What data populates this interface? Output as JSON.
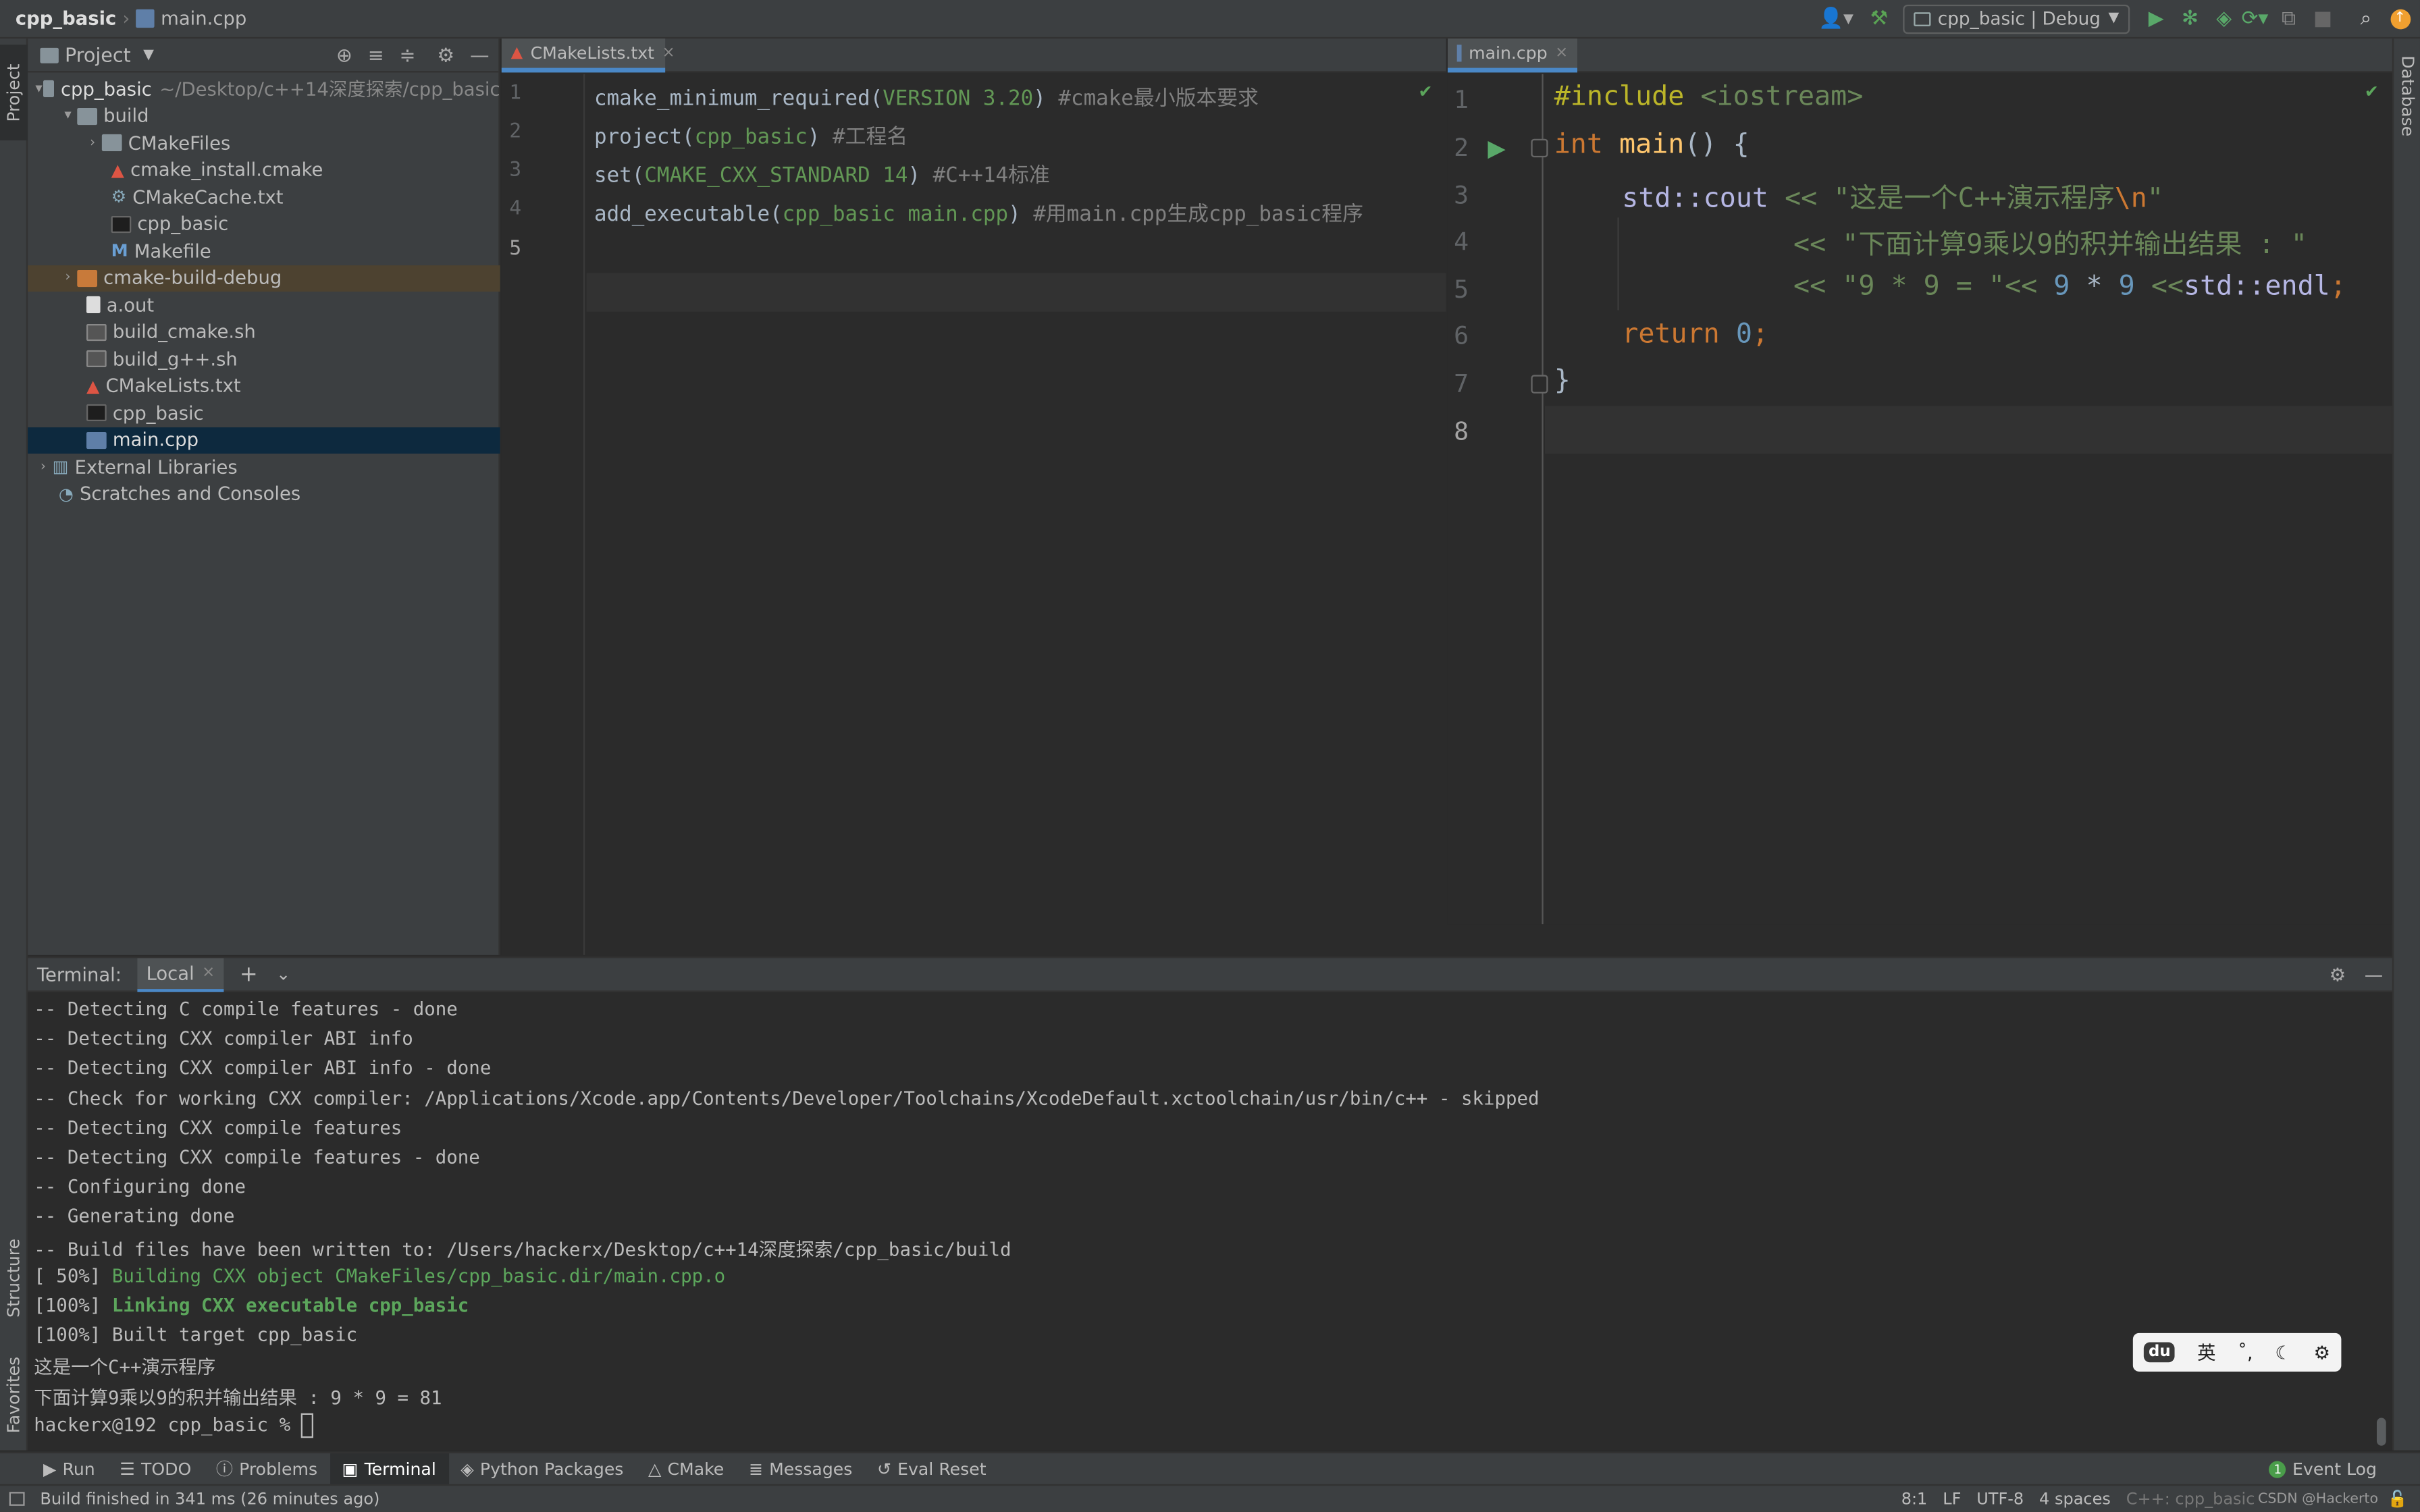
{
  "topbar": {
    "project": "cpp_basic",
    "file": "main.cpp",
    "run_config": "cpp_basic | Debug"
  },
  "sidebar_tabs": {
    "project": "Project",
    "structure": "Structure",
    "favorites": "Favorites",
    "database": "Database"
  },
  "project_panel": {
    "title": "Project",
    "root_name": "cpp_basic",
    "root_path": "~/Desktop/c++14深度探索/cpp_basic",
    "items": [
      {
        "label": "build"
      },
      {
        "label": "CMakeFiles"
      },
      {
        "label": "cmake_install.cmake"
      },
      {
        "label": "CMakeCache.txt"
      },
      {
        "label": "cpp_basic"
      },
      {
        "label": "Makefile"
      },
      {
        "label": "cmake-build-debug"
      },
      {
        "label": "a.out"
      },
      {
        "label": "build_cmake.sh"
      },
      {
        "label": "build_g++.sh"
      },
      {
        "label": "CMakeLists.txt"
      },
      {
        "label": "cpp_basic"
      },
      {
        "label": "main.cpp"
      },
      {
        "label": "External Libraries"
      },
      {
        "label": "Scratches and Consoles"
      }
    ]
  },
  "editor_left": {
    "tab": "CMakeLists.txt",
    "line_numbers": [
      "1",
      "2",
      "3",
      "4",
      "5"
    ],
    "lines": [
      {
        "a": "cmake_minimum_required(",
        "b": "VERSION 3.20",
        "c": ") ",
        "d": "#cmake最小版本要求"
      },
      {
        "a": "project(",
        "b": "cpp_basic",
        "c": ") ",
        "d": "#工程名"
      },
      {
        "a": "set(",
        "b": "CMAKE_CXX_STANDARD 14",
        "c": ") ",
        "d": "#C++14标准"
      },
      {
        "a": "add_executable(",
        "b": "cpp_basic main.cpp",
        "c": ") ",
        "d": "#用main.cpp生成cpp_basic程序"
      }
    ]
  },
  "editor_right": {
    "tab": "main.cpp",
    "line_numbers": [
      "1",
      "2",
      "3",
      "4",
      "5",
      "6",
      "7",
      "8"
    ],
    "code": {
      "l1_kw": "#include",
      "l1_hdr": " <iostream>",
      "l2_type": "int",
      "l2_fn": " main",
      "l2_rest": "() {",
      "l3_ns": "std::cout",
      "l3_op": " << ",
      "l3_str": "\"这是一个C++演示程序",
      "l3_esc": "\\n",
      "l3_end": "\"",
      "l4_op": "<< ",
      "l4_str": "\"下面计算9乘以9的积并输出结果 : \"",
      "l5_op": "<< ",
      "l5_str": "\"9 * 9 = \"",
      "l5_op2": "<< ",
      "l5_n1": "9",
      "l5_mul": " * ",
      "l5_n2": "9",
      "l5_op3": " <<",
      "l5_endl": "std::endl",
      "l5_semi": ";",
      "l6_kw": "return",
      "l6_num": " 0",
      "l6_semi": ";",
      "l7": "}"
    }
  },
  "terminal": {
    "label": "Terminal:",
    "tab": "Local",
    "lines": [
      "-- Detecting C compile features - done",
      "-- Detecting CXX compiler ABI info",
      "-- Detecting CXX compiler ABI info - done",
      "-- Check for working CXX compiler: /Applications/Xcode.app/Contents/Developer/Toolchains/XcodeDefault.xctoolchain/usr/bin/c++ - skipped",
      "-- Detecting CXX compile features",
      "-- Detecting CXX compile features - done",
      "-- Configuring done",
      "-- Generating done",
      "-- Build files have been written to: /Users/hackerx/Desktop/c++14深度探索/cpp_basic/build"
    ],
    "build1_prefix": "[ 50%] ",
    "build1_text": "Building CXX object CMakeFiles/cpp_basic.dir/main.cpp.o",
    "build2_prefix": "[100%] ",
    "build2_text": "Linking CXX executable cpp_basic",
    "build3": "[100%] Built target cpp_basic",
    "out1": "这是一个C++演示程序",
    "out2": "下面计算9乘以9的积并输出结果 : 9 * 9 = 81",
    "prompt": "hackerx@192 cpp_basic % "
  },
  "ime": {
    "lang": "英",
    "punct": "˚,",
    "logo": "du"
  },
  "bottom_tabs": [
    "Run",
    "TODO",
    "Problems",
    "Terminal",
    "Python Packages",
    "CMake",
    "Messages",
    "Eval Reset"
  ],
  "event_log": "Event Log",
  "status": {
    "message": "Build finished in 341 ms (26 minutes ago)",
    "position": "8:1",
    "line_sep": "LF",
    "encoding": "UTF-8",
    "indent": "4 spaces",
    "context": "C++: cpp_basic",
    "watermark": "CSDN @Hackerto"
  }
}
